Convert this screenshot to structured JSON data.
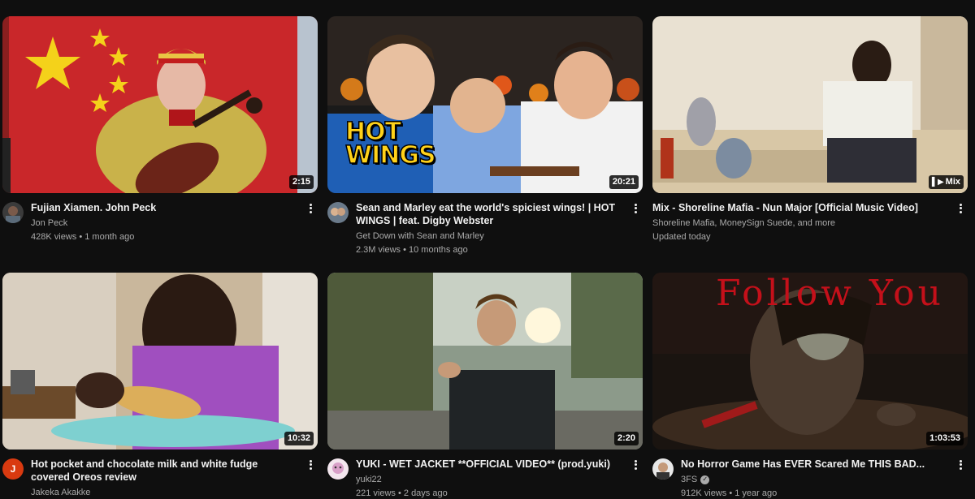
{
  "videos": [
    {
      "title": "Fujian Xiamen. John Peck",
      "channel": "Jon Peck",
      "views": "428K views",
      "age": "1 month ago",
      "duration": "2:15",
      "avatar_letter": "",
      "verified": false
    },
    {
      "title": "Sean and Marley eat the world's spiciest wings! | HOT WINGS | feat. Digby Webster",
      "channel": "Get Down with Sean and Marley",
      "views": "2.3M views",
      "age": "10 months ago",
      "duration": "20:21",
      "thumb_text": [
        "HOT",
        "WINGS"
      ],
      "avatar_letter": "",
      "verified": false
    },
    {
      "title": "Mix - Shoreline Mafia - Nun Major [Official Music Video]",
      "channel": "Shoreline Mafia, MoneySign Suede, and more",
      "views": "Updated today",
      "age": "",
      "duration": "Mix",
      "avatar_letter": "",
      "verified": false
    },
    {
      "title": "Hot pocket and chocolate milk and white fudge covered Oreos review",
      "channel": "Jakeka Akakke",
      "views": "",
      "age": "",
      "duration": "10:32",
      "avatar_letter": "J",
      "avatar_color": "#d93a10",
      "verified": false
    },
    {
      "title": "YUKI - WET JACKET **OFFICIAL VIDEO** (prod.yuki)",
      "channel": "yuki22",
      "views": "221 views",
      "age": "2 days ago",
      "duration": "2:20",
      "avatar_letter": "",
      "verified": false
    },
    {
      "title": "No Horror Game Has EVER Scared Me THIS BAD...",
      "channel": "3FS",
      "views": "912K views",
      "age": "1 year ago",
      "duration": "1:03:53",
      "thumb_text": "Follow You",
      "avatar_letter": "",
      "verified": true
    }
  ],
  "separator": " • ",
  "colors": {
    "background": "#0f0f0f",
    "title": "#f1f1f1",
    "meta": "#aaaaaa"
  }
}
